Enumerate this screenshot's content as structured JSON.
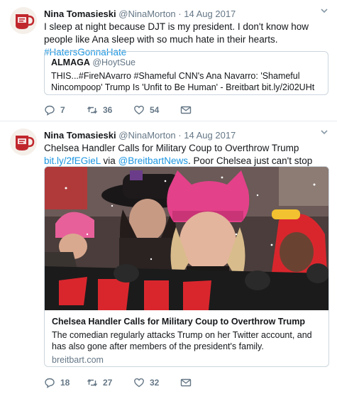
{
  "tweets": [
    {
      "author": {
        "name": "Nina Tomasieski",
        "handle": "@NinaMorton"
      },
      "separator": "·",
      "date": "14 Aug 2017",
      "text": {
        "p1": "I sleep at night because DJT is my president. I don't know how people like Ana sleep with so much hate in their hearts. ",
        "hashtag": "#HatersGonnaHate"
      },
      "quote": {
        "name": "ALMAGA",
        "handle": "@HoytSue",
        "text": "THIS...#FireNAvarro #Shameful CNN's Ana Navarro: 'Shameful Nincompoop' Trump Is 'Unfit to Be Human' - Breitbart bit.ly/2i02UHt"
      },
      "actions": {
        "replies": "7",
        "retweets": "36",
        "likes": "54"
      }
    },
    {
      "author": {
        "name": "Nina Tomasieski",
        "handle": "@NinaMorton"
      },
      "separator": "·",
      "date": "14 Aug 2017",
      "text": {
        "p1": "Chelsea Handler Calls for Military Coup to Overthrow Trump ",
        "link1": "bit.ly/2fEGieL",
        "p2": " via ",
        "link2": "@BreitbartNews",
        "p3": ". Poor Chelsea just can't stop the hate"
      },
      "card": {
        "title": "Chelsea Handler Calls for Military Coup to Overthrow Trump",
        "description": "The comedian regularly attacks Trump on her Twitter account, and has also gone after members of the president's family.",
        "domain": "breitbart.com"
      },
      "actions": {
        "replies": "18",
        "retweets": "27",
        "likes": "32"
      }
    }
  ],
  "colors": {
    "link": "#1b95e0",
    "secondary_text": "#657786",
    "border": "#ccd6dd",
    "avatar_mug": "#c0272d"
  },
  "icons": [
    "reply-icon",
    "retweet-icon",
    "like-icon",
    "message-icon",
    "chevron-down-icon"
  ]
}
